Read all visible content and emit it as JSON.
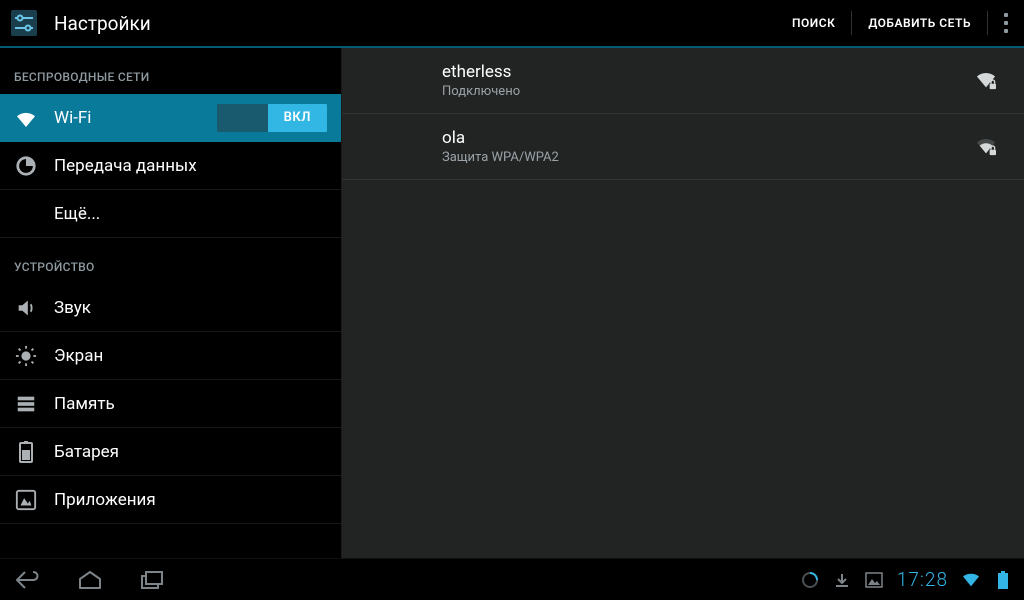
{
  "actionbar": {
    "title": "Настройки",
    "actions": [
      "ПОИСК",
      "ДОБАВИТЬ СЕТЬ"
    ]
  },
  "sidebar": {
    "sections": [
      {
        "header": "БЕСПРОВОДНЫЕ СЕТИ",
        "items": [
          {
            "label": "Wi-Fi",
            "toggle": "ВКЛ",
            "selected": true
          },
          {
            "label": "Передача данных"
          },
          {
            "label": "Ещё..."
          }
        ]
      },
      {
        "header": "УСТРОЙСТВО",
        "items": [
          {
            "label": "Звук"
          },
          {
            "label": "Экран"
          },
          {
            "label": "Память"
          },
          {
            "label": "Батарея"
          },
          {
            "label": "Приложения"
          }
        ]
      }
    ]
  },
  "networks": [
    {
      "name": "etherless",
      "status": "Подключено",
      "secured": true,
      "signal": "full"
    },
    {
      "name": "ola",
      "status": "Защита WPA/WPA2",
      "secured": true,
      "signal": "medium"
    }
  ],
  "statusbar": {
    "time": "17:28"
  }
}
